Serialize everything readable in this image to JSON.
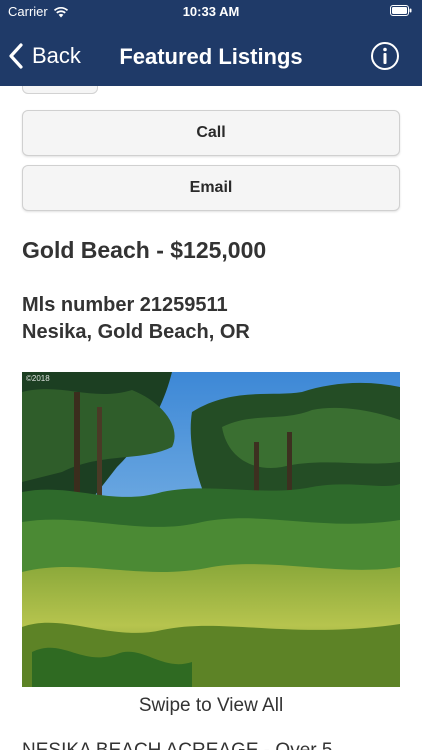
{
  "status_bar": {
    "carrier": "Carrier",
    "time": "10:33 AM",
    "icons": [
      "wifi-icon",
      "battery-icon"
    ]
  },
  "nav": {
    "back_label": "Back",
    "title": "Featured Listings",
    "info_icon": "info-icon",
    "background_color": "#1f3a68"
  },
  "actions": {
    "call_label": "Call",
    "email_label": "Email"
  },
  "listing": {
    "heading": "Gold Beach - $125,000",
    "mls": "Mls number 21259511",
    "location": "Nesika, Gold Beach, OR",
    "photo_watermark": "©2018",
    "swipe_hint": "Swipe to View All",
    "description_preview": "NESIKA BEACH ACREAGE - Over 5"
  }
}
